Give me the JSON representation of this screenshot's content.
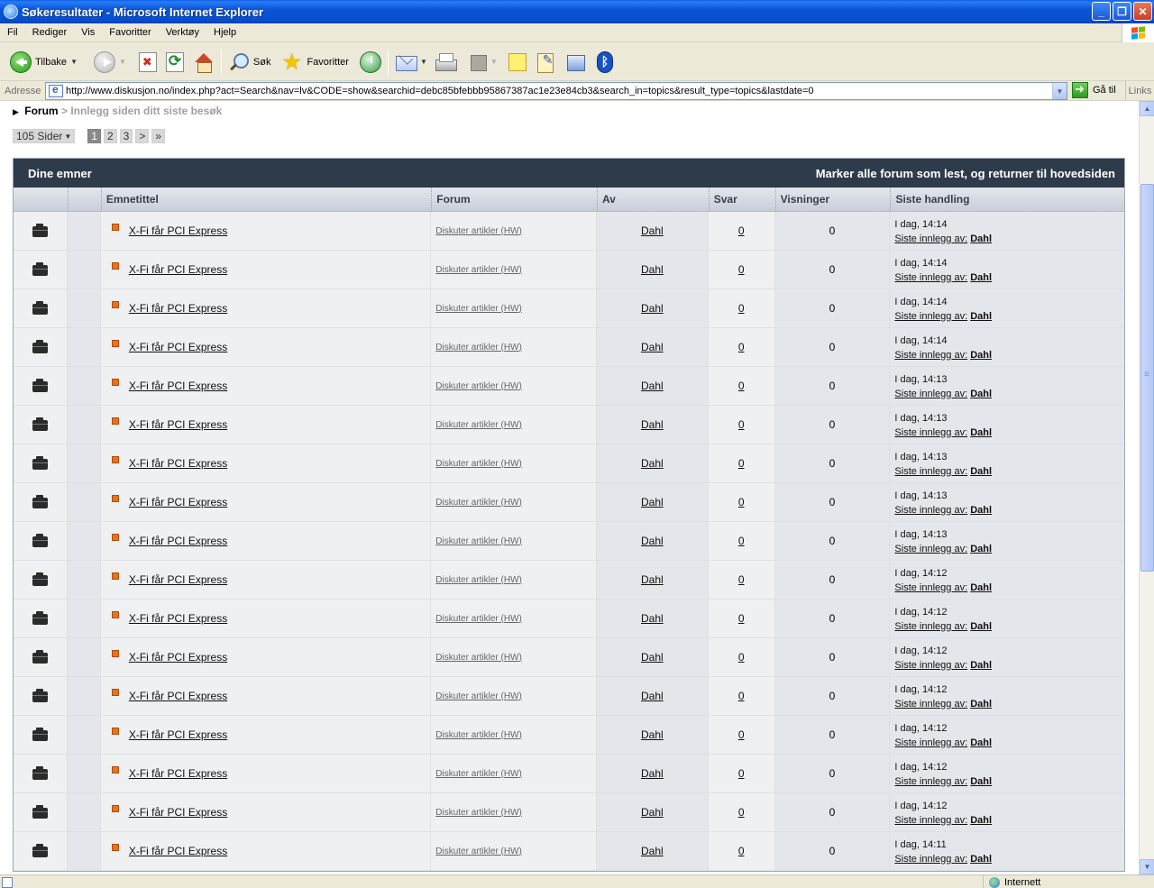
{
  "window": {
    "title": "Søkeresultater - Microsoft Internet Explorer",
    "minimize": "_",
    "maximize": "❐",
    "close": "✕"
  },
  "menu": [
    "Fil",
    "Rediger",
    "Vis",
    "Favoritter",
    "Verktøy",
    "Hjelp"
  ],
  "toolbar": {
    "back_label": "Tilbake",
    "search_label": "Søk",
    "favorites_label": "Favoritter"
  },
  "address": {
    "label": "Adresse",
    "url": "http://www.diskusjon.no/index.php?act=Search&nav=lv&CODE=show&searchid=debc85bfebbb95867387ac1e23e84cb3&search_in=topics&result_type=topics&lastdate=0",
    "go_label": "Gå til",
    "links_label": "Links"
  },
  "breadcrumb": {
    "forum": "Forum",
    "separator": ">",
    "current": "Innlegg siden ditt siste besøk"
  },
  "pager": {
    "pages_label": "105 Sider",
    "pages": [
      "1",
      "2",
      "3"
    ],
    "next": ">",
    "last": "»"
  },
  "topics": {
    "heading": "Dine emner",
    "mark_read": "Marker alle forum som lest, og returner til hovedsiden",
    "columns": {
      "title": "Emnetittel",
      "forum": "Forum",
      "author": "Av",
      "replies": "Svar",
      "views": "Visninger",
      "last_action": "Siste handling"
    },
    "last_by_label": "Siste innlegg av:",
    "rows": [
      {
        "title": "X-Fi får PCI Express",
        "forum": "Diskuter artikler (HW)",
        "author": "Dahl",
        "replies": "0",
        "views": "0",
        "date": "I dag, 14:14",
        "last_user": "Dahl"
      },
      {
        "title": "X-Fi får PCI Express",
        "forum": "Diskuter artikler (HW)",
        "author": "Dahl",
        "replies": "0",
        "views": "0",
        "date": "I dag, 14:14",
        "last_user": "Dahl"
      },
      {
        "title": "X-Fi får PCI Express",
        "forum": "Diskuter artikler (HW)",
        "author": "Dahl",
        "replies": "0",
        "views": "0",
        "date": "I dag, 14:14",
        "last_user": "Dahl"
      },
      {
        "title": "X-Fi får PCI Express",
        "forum": "Diskuter artikler (HW)",
        "author": "Dahl",
        "replies": "0",
        "views": "0",
        "date": "I dag, 14:14",
        "last_user": "Dahl"
      },
      {
        "title": "X-Fi får PCI Express",
        "forum": "Diskuter artikler (HW)",
        "author": "Dahl",
        "replies": "0",
        "views": "0",
        "date": "I dag, 14:13",
        "last_user": "Dahl"
      },
      {
        "title": "X-Fi får PCI Express",
        "forum": "Diskuter artikler (HW)",
        "author": "Dahl",
        "replies": "0",
        "views": "0",
        "date": "I dag, 14:13",
        "last_user": "Dahl"
      },
      {
        "title": "X-Fi får PCI Express",
        "forum": "Diskuter artikler (HW)",
        "author": "Dahl",
        "replies": "0",
        "views": "0",
        "date": "I dag, 14:13",
        "last_user": "Dahl"
      },
      {
        "title": "X-Fi får PCI Express",
        "forum": "Diskuter artikler (HW)",
        "author": "Dahl",
        "replies": "0",
        "views": "0",
        "date": "I dag, 14:13",
        "last_user": "Dahl"
      },
      {
        "title": "X-Fi får PCI Express",
        "forum": "Diskuter artikler (HW)",
        "author": "Dahl",
        "replies": "0",
        "views": "0",
        "date": "I dag, 14:13",
        "last_user": "Dahl"
      },
      {
        "title": "X-Fi får PCI Express",
        "forum": "Diskuter artikler (HW)",
        "author": "Dahl",
        "replies": "0",
        "views": "0",
        "date": "I dag, 14:12",
        "last_user": "Dahl"
      },
      {
        "title": "X-Fi får PCI Express",
        "forum": "Diskuter artikler (HW)",
        "author": "Dahl",
        "replies": "0",
        "views": "0",
        "date": "I dag, 14:12",
        "last_user": "Dahl"
      },
      {
        "title": "X-Fi får PCI Express",
        "forum": "Diskuter artikler (HW)",
        "author": "Dahl",
        "replies": "0",
        "views": "0",
        "date": "I dag, 14:12",
        "last_user": "Dahl"
      },
      {
        "title": "X-Fi får PCI Express",
        "forum": "Diskuter artikler (HW)",
        "author": "Dahl",
        "replies": "0",
        "views": "0",
        "date": "I dag, 14:12",
        "last_user": "Dahl"
      },
      {
        "title": "X-Fi får PCI Express",
        "forum": "Diskuter artikler (HW)",
        "author": "Dahl",
        "replies": "0",
        "views": "0",
        "date": "I dag, 14:12",
        "last_user": "Dahl"
      },
      {
        "title": "X-Fi får PCI Express",
        "forum": "Diskuter artikler (HW)",
        "author": "Dahl",
        "replies": "0",
        "views": "0",
        "date": "I dag, 14:12",
        "last_user": "Dahl"
      },
      {
        "title": "X-Fi får PCI Express",
        "forum": "Diskuter artikler (HW)",
        "author": "Dahl",
        "replies": "0",
        "views": "0",
        "date": "I dag, 14:12",
        "last_user": "Dahl"
      },
      {
        "title": "X-Fi får PCI Express",
        "forum": "Diskuter artikler (HW)",
        "author": "Dahl",
        "replies": "0",
        "views": "0",
        "date": "I dag, 14:11",
        "last_user": "Dahl"
      }
    ]
  },
  "status": {
    "zone": "Internett"
  }
}
